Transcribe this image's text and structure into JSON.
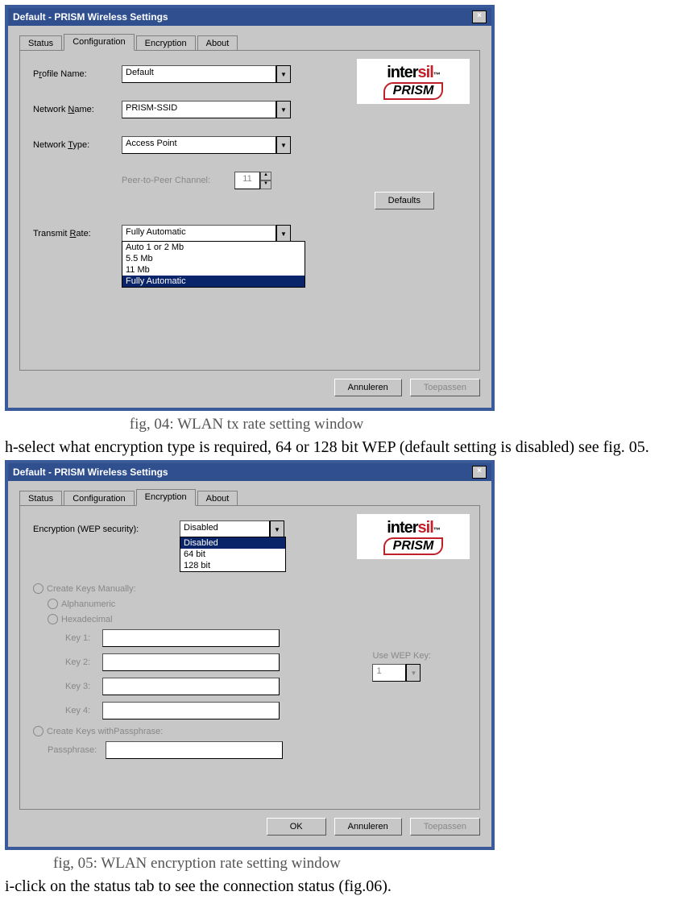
{
  "win1": {
    "title": "Default - PRISM Wireless Settings",
    "close": "×",
    "tabs": [
      "Status",
      "Configuration",
      "Encryption",
      "About"
    ],
    "active_tab": 1,
    "logo": {
      "brand1a": "inter",
      "brand1b": "sil",
      "tm": "™",
      "brand2": "PRISM"
    },
    "profile_label_pre": "P",
    "profile_label_und": "r",
    "profile_label_post": "ofile Name:",
    "profile_value": "Default",
    "network_label_pre": "Network ",
    "network_label_und": "N",
    "network_label_post": "ame:",
    "network_value": "PRISM-SSID",
    "type_label_pre": "Network ",
    "type_label_und": "T",
    "type_label_post": "ype:",
    "type_value": "Access Point",
    "p2p_label": "Peer-to-Peer Channel:",
    "p2p_value": "11",
    "defaults_btn_und": "D",
    "defaults_btn_rest": "efaults",
    "rate_label_pre": "Transmit ",
    "rate_label_und": "R",
    "rate_label_post": "ate:",
    "rate_value": "Fully Automatic",
    "rate_options": [
      "Auto 1 or 2 Mb",
      "5.5 Mb",
      "11 Mb",
      "Fully Automatic"
    ],
    "btn_cancel": "Annuleren",
    "btn_apply": "Toepassen"
  },
  "caption1": "fig, 04: WLAN tx rate setting window",
  "para_h": "h-select what encryption type is required, 64 or 128 bit WEP (default setting is disabled) see fig. 05.",
  "win2": {
    "title": "Default - PRISM Wireless Settings",
    "close": "×",
    "tabs": [
      "Status",
      "Configuration",
      "Encryption",
      "About"
    ],
    "active_tab": 2,
    "logo": {
      "brand1a": "inter",
      "brand1b": "sil",
      "tm": "™",
      "brand2": "PRISM"
    },
    "enc_label_und": "E",
    "enc_label_rest": "ncryption (WEP security):",
    "enc_value": "Disabled",
    "enc_options": [
      "Disabled",
      "64 bit",
      "128 bit"
    ],
    "create_manual": "Create Keys Manually:",
    "alpha": "Alphanumeric",
    "hex": "Hexadecimal",
    "key_labels": [
      "Key 1:",
      "Key 2:",
      "Key 3:",
      "Key 4:"
    ],
    "usewep_label": "Use WEP Key:",
    "usewep_value": "1",
    "create_pass_pre": "Create Keys with ",
    "create_pass_und": "P",
    "create_pass_post": "assphrase:",
    "pass_label": "Passphrase:",
    "btn_ok": "OK",
    "btn_cancel": "Annuleren",
    "btn_apply": "Toepassen"
  },
  "caption2": "fig, 05: WLAN encryption rate setting window",
  "para_i": "i-click on the status tab to see the connection status (fig.06)."
}
